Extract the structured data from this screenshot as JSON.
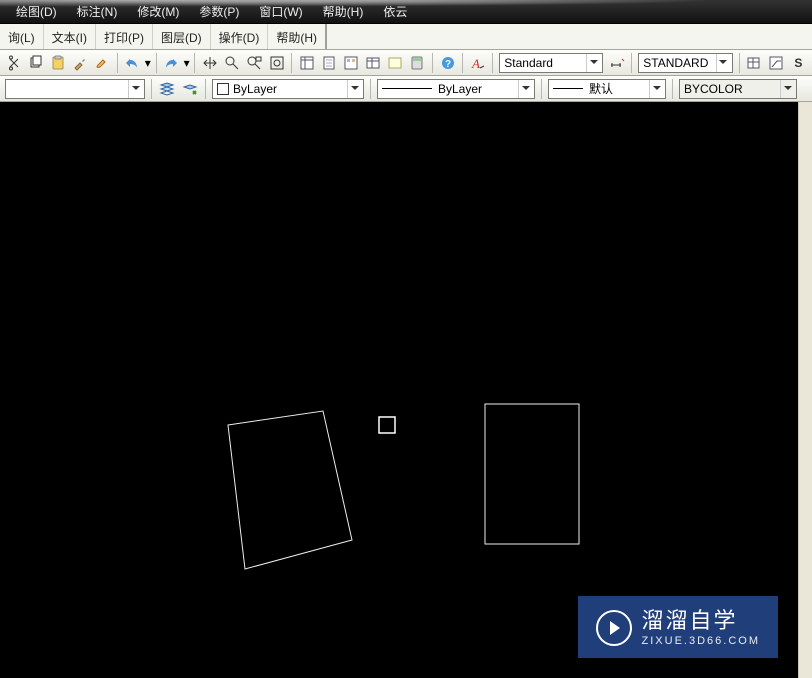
{
  "menu": {
    "items": [
      "绘图(D)",
      "标注(N)",
      "修改(M)",
      "参数(P)",
      "窗口(W)",
      "帮助(H)",
      "依云"
    ]
  },
  "submenu": {
    "tabs": [
      "询(L)",
      "文本(I)",
      "打印(P)",
      "图层(D)",
      "操作(D)",
      "帮助(H)"
    ]
  },
  "toolbar1": {
    "style_dd1": "Standard",
    "style_dd2": "STANDARD"
  },
  "toolbar2": {
    "layer_dd": "",
    "color_dd": "ByLayer",
    "linetype_dd": "ByLayer",
    "lineweight_dd": "默认",
    "plotstyle_dd": "BYCOLOR"
  },
  "watermark": {
    "main": "溜溜自学",
    "sub": "ZIXUE.3D66.COM"
  }
}
